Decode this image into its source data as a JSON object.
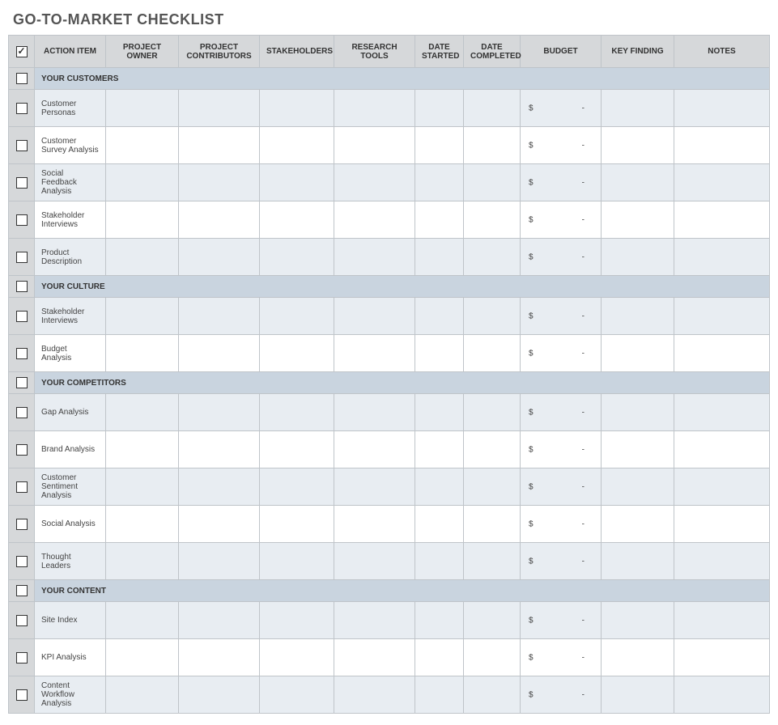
{
  "title": "GO-TO-MARKET CHECKLIST",
  "headers": {
    "action": "ACTION ITEM",
    "owner": "PROJECT OWNER",
    "contributors": "PROJECT CONTRIBUTORS",
    "stakeholders": "STAKEHOLDERS",
    "research": "RESEARCH TOOLS",
    "date_started": "DATE STARTED",
    "date_completed": "DATE COMPLETED",
    "budget": "BUDGET",
    "key_finding": "KEY FINDING",
    "notes": "NOTES"
  },
  "budget_symbol": "$",
  "budget_placeholder": "-",
  "sections": [
    {
      "title": "YOUR CUSTOMERS",
      "items": [
        {
          "action": "Customer Personas"
        },
        {
          "action": "Customer Survey Analysis"
        },
        {
          "action": "Social Feedback Analysis"
        },
        {
          "action": "Stakeholder Interviews"
        },
        {
          "action": "Product Description"
        }
      ]
    },
    {
      "title": "YOUR CULTURE",
      "items": [
        {
          "action": "Stakeholder Interviews"
        },
        {
          "action": "Budget Analysis"
        }
      ]
    },
    {
      "title": "YOUR COMPETITORS",
      "items": [
        {
          "action": "Gap Analysis"
        },
        {
          "action": "Brand Analysis"
        },
        {
          "action": "Customer Sentiment Analysis"
        },
        {
          "action": "Social Analysis"
        },
        {
          "action": "Thought Leaders"
        }
      ]
    },
    {
      "title": "YOUR CONTENT",
      "items": [
        {
          "action": "Site Index"
        },
        {
          "action": "KPI Analysis"
        },
        {
          "action": "Content Workflow Analysis"
        }
      ]
    }
  ]
}
